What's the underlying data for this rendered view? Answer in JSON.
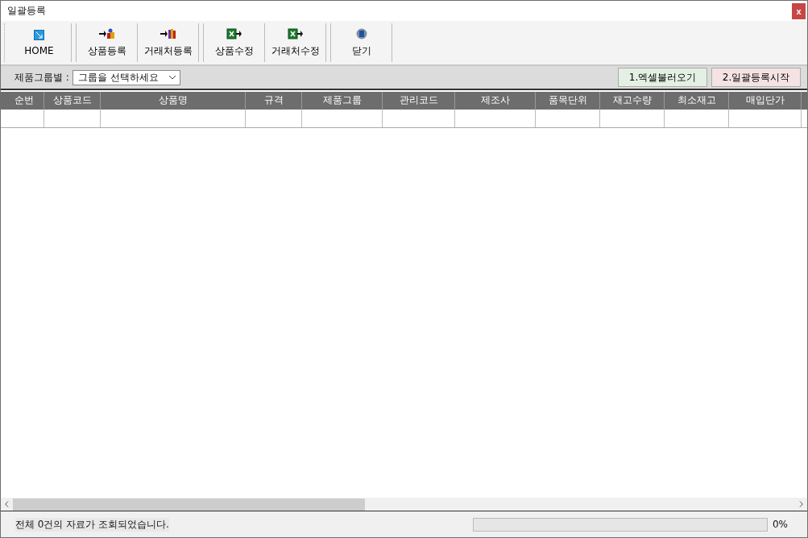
{
  "window": {
    "title": "일괄등록",
    "close": "x"
  },
  "toolbar": [
    {
      "label": "HOME",
      "kind": "home"
    },
    {
      "label": "상품등록",
      "kind": "product"
    },
    {
      "label": "거래처등록",
      "kind": "client"
    },
    {
      "label": "상품수정",
      "kind": "excel"
    },
    {
      "label": "거래처수정",
      "kind": "excel"
    },
    {
      "label": "닫기",
      "kind": "close"
    }
  ],
  "filter": {
    "label": "제품그룹별 :",
    "dropdown": "그룹을 선택하세요"
  },
  "actions": [
    {
      "label": "1.엑셀불러오기",
      "color": "#e3f0e3"
    },
    {
      "label": "2.일괄등록시작",
      "color": "#f5e3e3"
    }
  ],
  "table": {
    "columns": [
      "순번",
      "상품코드",
      "상품명",
      "규격",
      "제품그룹",
      "관리코드",
      "제조사",
      "품목단위",
      "재고수량",
      "최소재고",
      "매입단가"
    ]
  },
  "status_bar": {
    "message": "전체 0건의 자료가 조회되었습니다.",
    "progress": {
      "level": 0
    },
    "percent": "0%"
  }
}
